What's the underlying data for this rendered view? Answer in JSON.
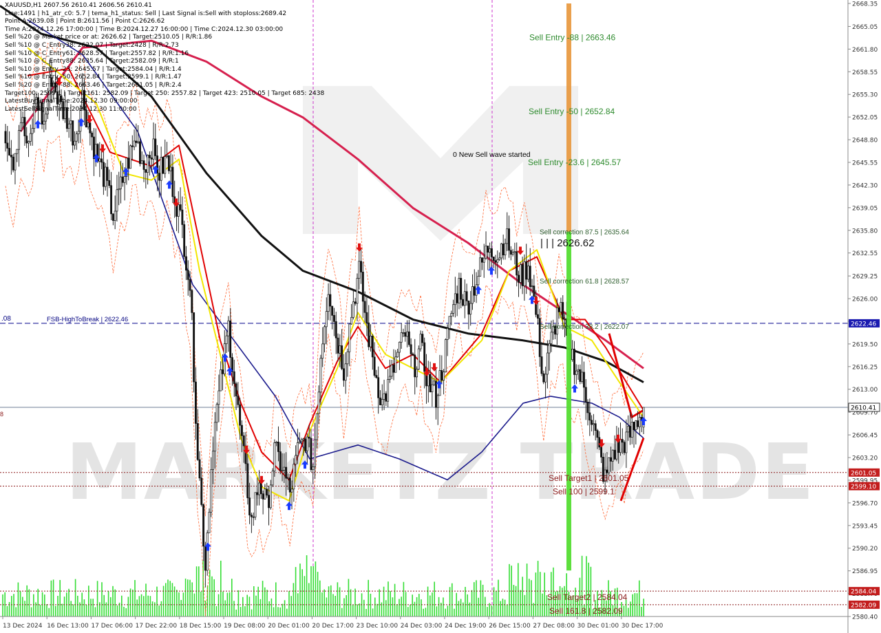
{
  "window": {
    "symbol_line": "XAUUSD,H1 2607.56 2610.41 2606.56 2610.41"
  },
  "info_lines": [
    "Line:1491 | h1_atr_c0: 5.7 | tema_h1_status: Sell | Last Signal is:Sell with stoploss:2689.42",
    "Point A:2639.08 | Point B:2611.56 | Point C:2626.62",
    "Time A:2024.12.26 17:00:00 | Time B:2024.12.27 16:00:00 | Time C:2024.12.30 03:00:00",
    "Sell %20 @ Market price or at: 2626.62 | Target:2510.05 | R/R:1.86",
    "Sell %10 @ C_Entry38: 2622.07 | Target:2428 | R/R:2.73",
    "Sell %10 @ C_Entry61: 2628.57 | Target:2557.82 | R/R:1.16",
    "Sell %10 @ C_Entry88: 2635.64 | Target:2582.09 | R/R:1",
    "Sell %10 @ Entry -23: 2645.57 | Target:2584.04 | R/R:1.4",
    "Sell %10 @ Entry -50: 2652.84 | Target:2599.1 | R/R:1.47",
    "Sell %20 @ Entry -88: 2663.46 | Target:2601.05 | R/R:2.4",
    "Target100: 2599.1 | Target161: 2582.09 | Target 250: 2557.82 | Target 423: 2510.05 | Target 685: 2438",
    "LatestBuySignalTime:2024.12.30 09:00:00",
    "LatestSellSignalTime:2024.12.30 11:00:00"
  ],
  "watermark": "MARKETZ TRADE",
  "annotations": {
    "new_wave": "0 New Sell wave started",
    "point_c": "| | | 2626.62",
    "left_price_fragment": ".08",
    "left_edge_mark": "8"
  },
  "chart_data": {
    "type": "candlestick",
    "symbol": "XAUUSD",
    "timeframe": "H1",
    "ohlc_last": {
      "open": 2607.56,
      "high": 2610.41,
      "low": 2606.56,
      "close": 2610.41
    },
    "ylim": [
      2580.4,
      2668.35
    ],
    "y_ticks": [
      2668.35,
      2665.05,
      2661.8,
      2658.55,
      2655.3,
      2652.05,
      2648.8,
      2645.55,
      2642.3,
      2639.05,
      2635.8,
      2632.55,
      2629.25,
      2626.0,
      2622.75,
      2619.5,
      2616.25,
      2613.0,
      2609.7,
      2606.45,
      2603.2,
      2599.95,
      2596.7,
      2593.45,
      2590.2,
      2586.95,
      2583.7,
      2580.4
    ],
    "x_labels": [
      "13 Dec 2024",
      "16 Dec 13:00",
      "17 Dec 06:00",
      "17 Dec 22:00",
      "18 Dec 15:00",
      "19 Dec 08:00",
      "20 Dec 01:00",
      "20 Dec 17:00",
      "23 Dec 10:00",
      "24 Dec 03:00",
      "24 Dec 19:00",
      "26 Dec 15:00",
      "27 Dec 08:00",
      "30 Dec 01:00",
      "30 Dec 17:00"
    ],
    "close_path": [
      2650,
      2646,
      2652,
      2647,
      2655,
      2651,
      2658,
      2654,
      2652,
      2649,
      2655,
      2650,
      2646,
      2643,
      2638,
      2642,
      2646,
      2649,
      2645,
      2648,
      2644,
      2646,
      2641,
      2636,
      2628,
      2604,
      2588,
      2606,
      2614,
      2622,
      2612,
      2603,
      2594,
      2600,
      2596,
      2604,
      2602,
      2598,
      2604,
      2606,
      2602,
      2618,
      2628,
      2621,
      2616,
      2624,
      2630,
      2622,
      2616,
      2611,
      2614,
      2618,
      2621,
      2616,
      2619,
      2614,
      2612,
      2617,
      2624,
      2628,
      2625,
      2628,
      2631,
      2634,
      2632,
      2635,
      2632,
      2629,
      2631,
      2624,
      2614,
      2620,
      2625,
      2620,
      2617,
      2614,
      2610,
      2605,
      2600,
      2604,
      2605,
      2606,
      2608,
      2610.41
    ],
    "horizontal_levels": [
      {
        "label": "FSB-HighToBreak | 2622.46",
        "value": 2622.46,
        "color": "#00008b",
        "style": "dashed",
        "badge": "2622.46"
      },
      {
        "label": "",
        "value": 2610.41,
        "color": "#6e7b95",
        "style": "solid",
        "badge": "2610.41"
      },
      {
        "label": "Sell Target1 | 2601.05",
        "value": 2601.05,
        "color": "#8b1a1a",
        "style": "dotted",
        "badge": "2601.05"
      },
      {
        "label": "Sell 100 | 2599.1",
        "value": 2599.1,
        "color": "#8b1a1a",
        "style": "dotted",
        "badge": "2599.10"
      },
      {
        "label": "Sell Target2 | 2584.04",
        "value": 2584.04,
        "color": "#8b1a1a",
        "style": "dotted",
        "badge": "2584.04"
      },
      {
        "label": "Sell 161.8 | 2582.09",
        "value": 2582.09,
        "color": "#8b1a1a",
        "style": "dotted",
        "badge": "2582.09"
      }
    ],
    "entry_labels": [
      {
        "text": "Sell Entry -88 | 2663.46",
        "value": 2663.46
      },
      {
        "text": "Sell Entry -50 | 2652.84",
        "value": 2652.84
      },
      {
        "text": "Sell Entry -23.6 | 2645.57",
        "value": 2645.57
      },
      {
        "text": "Sell correction 87.5 | 2635.64",
        "value": 2635.64
      },
      {
        "text": "Sell correction 61.8 | 2628.57",
        "value": 2628.57
      },
      {
        "text": "Sell correction 38.2 | 2622.07",
        "value": 2622.07
      }
    ],
    "ma_black": [
      [
        0,
        2668
      ],
      [
        60,
        2664
      ],
      [
        140,
        2662
      ],
      [
        220,
        2655
      ],
      [
        300,
        2644
      ],
      [
        380,
        2635
      ],
      [
        440,
        2630
      ],
      [
        520,
        2627
      ],
      [
        600,
        2623
      ],
      [
        680,
        2621
      ],
      [
        760,
        2620
      ],
      [
        820,
        2619
      ],
      [
        880,
        2617
      ],
      [
        935,
        2614
      ]
    ],
    "ma_crimson": [
      [
        30,
        2650
      ],
      [
        120,
        2662
      ],
      [
        220,
        2663
      ],
      [
        300,
        2660
      ],
      [
        380,
        2655
      ],
      [
        440,
        2652
      ],
      [
        520,
        2646
      ],
      [
        600,
        2639
      ],
      [
        680,
        2634
      ],
      [
        760,
        2628
      ],
      [
        820,
        2624
      ],
      [
        880,
        2620
      ],
      [
        935,
        2616
      ]
    ],
    "ma_navy": [
      [
        40,
        2666
      ],
      [
        120,
        2661
      ],
      [
        200,
        2650
      ],
      [
        280,
        2628
      ],
      [
        340,
        2620
      ],
      [
        400,
        2612
      ],
      [
        450,
        2603
      ],
      [
        520,
        2605
      ],
      [
        580,
        2603
      ],
      [
        650,
        2600
      ],
      [
        700,
        2604
      ],
      [
        760,
        2611
      ],
      [
        800,
        2612
      ],
      [
        860,
        2611
      ],
      [
        900,
        2609
      ],
      [
        935,
        2606
      ]
    ],
    "ma_red": [
      [
        40,
        2658
      ],
      [
        100,
        2659
      ],
      [
        160,
        2647
      ],
      [
        220,
        2645
      ],
      [
        260,
        2648
      ],
      [
        290,
        2634
      ],
      [
        320,
        2620
      ],
      [
        350,
        2611
      ],
      [
        380,
        2604
      ],
      [
        420,
        2600
      ],
      [
        450,
        2608
      ],
      [
        490,
        2617
      ],
      [
        520,
        2622
      ],
      [
        560,
        2616
      ],
      [
        600,
        2618
      ],
      [
        640,
        2614
      ],
      [
        700,
        2621
      ],
      [
        740,
        2630
      ],
      [
        780,
        2632
      ],
      [
        820,
        2623
      ],
      [
        850,
        2623
      ],
      [
        880,
        2619
      ],
      [
        910,
        2614
      ],
      [
        935,
        2610
      ]
    ],
    "ma_yellow": [
      [
        40,
        2662
      ],
      [
        90,
        2658
      ],
      [
        140,
        2654
      ],
      [
        180,
        2644
      ],
      [
        220,
        2643
      ],
      [
        260,
        2646
      ],
      [
        290,
        2630
      ],
      [
        320,
        2618
      ],
      [
        350,
        2606
      ],
      [
        380,
        2599
      ],
      [
        420,
        2597
      ],
      [
        450,
        2607
      ],
      [
        490,
        2616
      ],
      [
        520,
        2624
      ],
      [
        560,
        2618
      ],
      [
        600,
        2616
      ],
      [
        640,
        2614
      ],
      [
        700,
        2620
      ],
      [
        740,
        2630
      ],
      [
        780,
        2633
      ],
      [
        820,
        2622
      ],
      [
        860,
        2620
      ],
      [
        900,
        2614
      ],
      [
        935,
        2609
      ]
    ],
    "buy_arrows_x": [
      55,
      118,
      140,
      183,
      226,
      246,
      334,
      327,
      302,
      443,
      420,
      638,
      695,
      714,
      773,
      835,
      935
    ],
    "sell_arrows_x": [
      86,
      130,
      149,
      256,
      380,
      358,
      522,
      620,
      631,
      756,
      779,
      874,
      898
    ]
  }
}
